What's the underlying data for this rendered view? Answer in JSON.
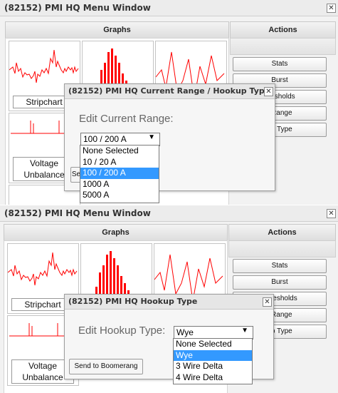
{
  "top": {
    "title": "(82152) PMI HQ Menu Window",
    "close": "✕",
    "graphs_header": "Graphs",
    "actions_header": "Actions",
    "tiles": {
      "stripchart": "Stripchart",
      "voltage": "Voltage",
      "unbalance": "Unbalance"
    },
    "actions": [
      "Stats",
      "Burst",
      "hresholds",
      "t Range",
      "up Type"
    ],
    "send_partial": "Se",
    "dialog": {
      "title": "(82152) PMI HQ Current Range / Hookup Type",
      "close": "✕",
      "label": "Edit Current Range:",
      "selected": "100 / 200 A",
      "arrow": "▼",
      "options": [
        "None Selected",
        "10 / 20 A",
        "100 / 200 A",
        "1000 A",
        "5000 A"
      ]
    }
  },
  "bottom": {
    "title": "(82152) PMI HQ Menu Window",
    "close": "✕",
    "graphs_header": "Graphs",
    "actions_header": "Actions",
    "tiles": {
      "stripchart": "Stripchart",
      "voltage": "Voltage",
      "unbalance": "Unbalance"
    },
    "actions": [
      "Stats",
      "Burst",
      "Thresholds",
      "t Range",
      "up Type"
    ],
    "dialog": {
      "title": "(82152) PMI HQ Hookup Type",
      "close": "✕",
      "label": "Edit Hookup Type:",
      "selected": "Wye",
      "arrow": "▼",
      "options": [
        "None Selected",
        "Wye",
        "3 Wire Delta",
        "4 Wire Delta"
      ],
      "send_button": "Send to Boomerang"
    }
  },
  "colors": {
    "trace": "#ff0000",
    "selection": "#3399ff"
  },
  "icons": {
    "close": "close-icon",
    "dropdown": "chevron-down-icon"
  }
}
